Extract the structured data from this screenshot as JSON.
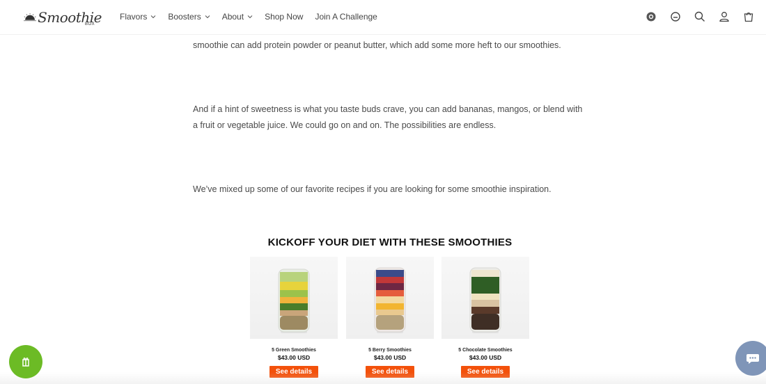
{
  "header": {
    "logo_text": "Smoothie",
    "logo_sub": "BOX",
    "nav": [
      {
        "label": "Flavors",
        "dropdown": true
      },
      {
        "label": "Boosters",
        "dropdown": true
      },
      {
        "label": "About",
        "dropdown": true
      },
      {
        "label": "Shop Now",
        "dropdown": false
      },
      {
        "label": "Join A Challenge",
        "dropdown": false
      }
    ],
    "icons": [
      "rewards-badge-icon",
      "chat-icon",
      "search-icon",
      "account-icon",
      "cart-icon"
    ]
  },
  "article": {
    "p1": "smoothie can add protein powder or peanut butter, which add some more heft to our smoothies.",
    "p2": "And if a hint of sweetness is what you taste buds crave, you can add bananas, mangos, or blend with a fruit or vegetable juice. We could go on and on. The possibilities are endless.",
    "p3": "We’ve mixed up some of our favorite recipes if you are looking for some smoothie inspiration."
  },
  "section": {
    "title": "KICKOFF YOUR DIET WITH THESE SMOOTHIES"
  },
  "products": [
    {
      "name": "5 Green Smoothies",
      "price": "$43.00 USD",
      "button": "See details"
    },
    {
      "name": "5 Berry Smoothies",
      "price": "$43.00 USD",
      "button": "See details"
    },
    {
      "name": "5 Chocolate Smoothies",
      "price": "$43.00 USD",
      "button": "See details"
    }
  ],
  "colors": {
    "accent": "#f3510b",
    "rewards_bubble": "#6cbb25",
    "chat_bubble": "#7f95b8"
  }
}
